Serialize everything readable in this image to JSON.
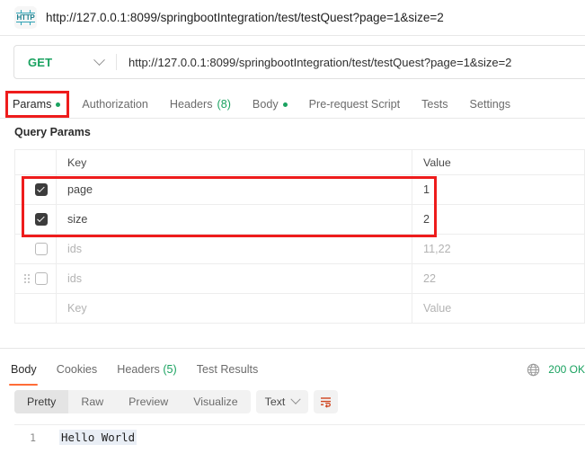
{
  "titlebar": {
    "icon": "http-protocol-icon",
    "url": "http://127.0.0.1:8099/springbootIntegration/test/testQuest?page=1&size=2"
  },
  "request_bar": {
    "method": "GET",
    "method_color": "#1aa260",
    "url": "http://127.0.0.1:8099/springbootIntegration/test/testQuest?page=1&size=2",
    "chevron": "chevron-down-icon"
  },
  "request_tabs": [
    {
      "label": "Params",
      "dot": true,
      "count": "",
      "active": true
    },
    {
      "label": "Authorization",
      "dot": false,
      "count": "",
      "active": false
    },
    {
      "label": "Headers",
      "dot": false,
      "count": "(8)",
      "active": false
    },
    {
      "label": "Body",
      "dot": true,
      "count": "",
      "active": false
    },
    {
      "label": "Pre-request Script",
      "dot": false,
      "count": "",
      "active": false
    },
    {
      "label": "Tests",
      "dot": false,
      "count": "",
      "active": false
    },
    {
      "label": "Settings",
      "dot": false,
      "count": "",
      "active": false
    }
  ],
  "query_params": {
    "section_title": "Query Params",
    "columns": {
      "key": "Key",
      "value": "Value"
    },
    "rows": [
      {
        "checked": true,
        "grip": false,
        "key": "page",
        "value": "1",
        "placeholder": false
      },
      {
        "checked": true,
        "grip": false,
        "key": "size",
        "value": "2",
        "placeholder": false
      },
      {
        "checked": false,
        "grip": false,
        "key": "ids",
        "value": "11,22",
        "placeholder": false
      },
      {
        "checked": false,
        "grip": true,
        "key": "ids",
        "value": "22",
        "placeholder": false
      },
      {
        "checked": null,
        "grip": false,
        "key": "Key",
        "value": "Value",
        "placeholder": true
      }
    ]
  },
  "highlights": {
    "color": "#ee1c1c",
    "params_tab": "Params",
    "param_rows": "page and size rows"
  },
  "response": {
    "tabs": [
      {
        "label": "Body",
        "count": "",
        "active": true
      },
      {
        "label": "Cookies",
        "count": "",
        "active": false
      },
      {
        "label": "Headers",
        "count": "(5)",
        "active": false
      },
      {
        "label": "Test Results",
        "count": "",
        "active": false
      }
    ],
    "status": {
      "icon": "globe-icon",
      "text": "200 OK",
      "color": "#1aa260"
    },
    "view_modes": [
      {
        "label": "Pretty",
        "active": true
      },
      {
        "label": "Raw",
        "active": false
      },
      {
        "label": "Preview",
        "active": false
      },
      {
        "label": "Visualize",
        "active": false
      }
    ],
    "format": {
      "label": "Text",
      "chevron": "chevron-down-icon"
    },
    "wrap_button": "wrap-lines-icon",
    "body": {
      "lines": [
        {
          "number": "1",
          "text": "Hello World"
        }
      ]
    }
  }
}
